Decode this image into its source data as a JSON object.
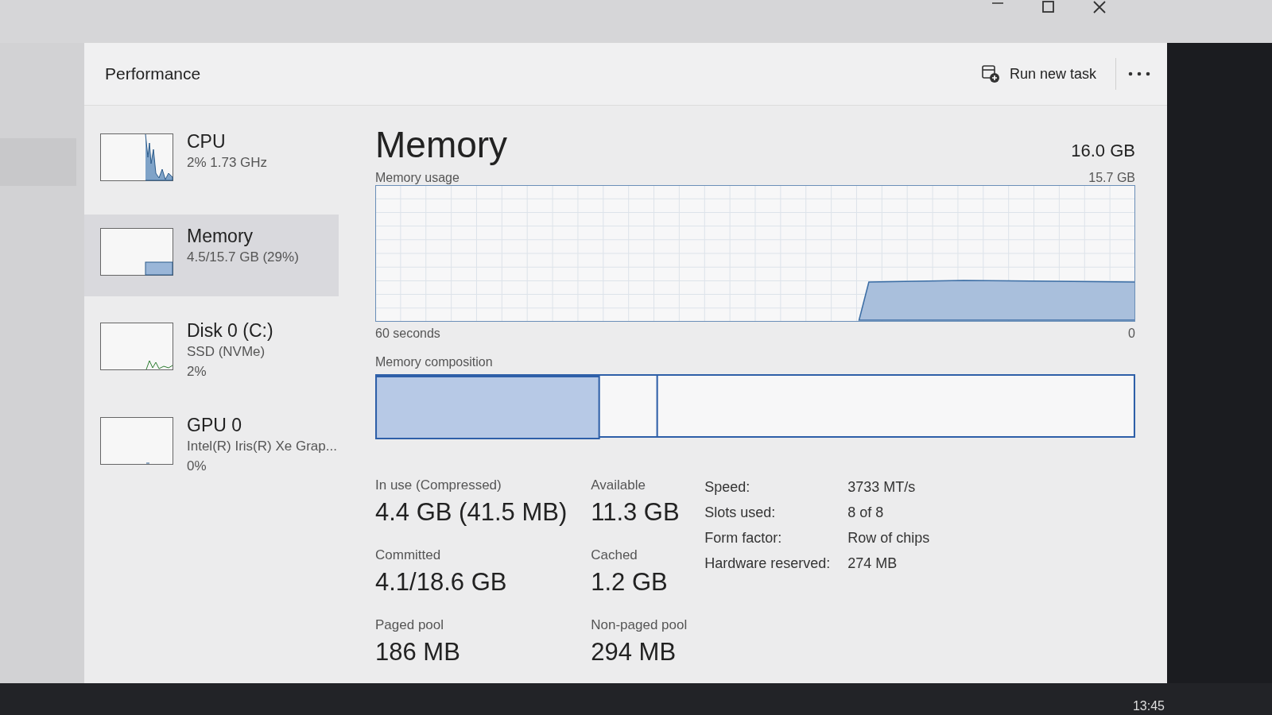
{
  "header": {
    "title": "Performance",
    "run_new_task": "Run new task"
  },
  "sidebar": {
    "items": [
      {
        "kind": "cpu",
        "name": "CPU",
        "lines": [
          "2%  1.73 GHz"
        ],
        "selected": false
      },
      {
        "kind": "memory",
        "name": "Memory",
        "lines": [
          "4.5/15.7 GB (29%)"
        ],
        "selected": true
      },
      {
        "kind": "disk",
        "name": "Disk 0 (C:)",
        "lines": [
          "SSD (NVMe)",
          "2%"
        ],
        "selected": false
      },
      {
        "kind": "gpu",
        "name": "GPU 0",
        "lines": [
          "Intel(R) Iris(R) Xe Grap...",
          "0%"
        ],
        "selected": false
      }
    ]
  },
  "main": {
    "title": "Memory",
    "total": "16.0 GB",
    "usage_chart": {
      "label": "Memory usage",
      "max_label": "15.7 GB",
      "time_label": "60 seconds",
      "min_label": "0"
    },
    "composition": {
      "label": "Memory composition"
    },
    "stats": [
      {
        "label": "In use (Compressed)",
        "value": "4.4 GB (41.5 MB)"
      },
      {
        "label": "Available",
        "value": "11.3 GB"
      },
      {
        "label": "Committed",
        "value": "4.1/18.6 GB"
      },
      {
        "label": "Cached",
        "value": "1.2 GB"
      },
      {
        "label": "Paged pool",
        "value": "186 MB"
      },
      {
        "label": "Non-paged pool",
        "value": "294 MB"
      }
    ],
    "details": [
      {
        "label": "Speed:",
        "value": "3733 MT/s"
      },
      {
        "label": "Slots used:",
        "value": "8 of 8"
      },
      {
        "label": "Form factor:",
        "value": "Row of chips"
      },
      {
        "label": "Hardware reserved:",
        "value": "274 MB"
      }
    ]
  },
  "taskbar": {
    "time": "13:45"
  }
}
